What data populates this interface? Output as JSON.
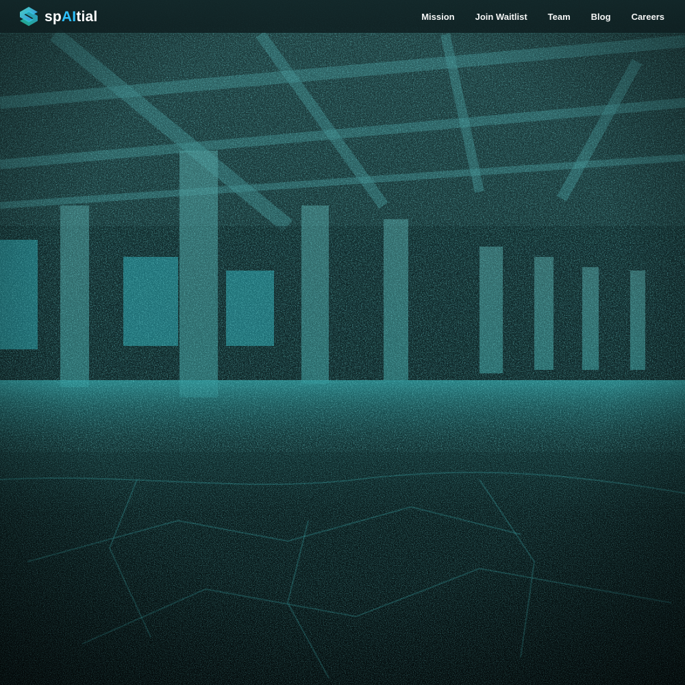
{
  "brand": {
    "name_prefix": "sp",
    "name_ai": "AI",
    "name_suffix": "tial",
    "logo_icon": "spatial-logo-icon",
    "accent_color": "#2ec2ff"
  },
  "nav": {
    "items": [
      {
        "label": "Mission"
      },
      {
        "label": "Join Waitlist"
      },
      {
        "label": "Team"
      },
      {
        "label": "Blog"
      },
      {
        "label": "Careers"
      }
    ]
  },
  "hero": {
    "image": "point-cloud-scan-of-parking-garage",
    "tint_color": "#2fb5b5"
  }
}
